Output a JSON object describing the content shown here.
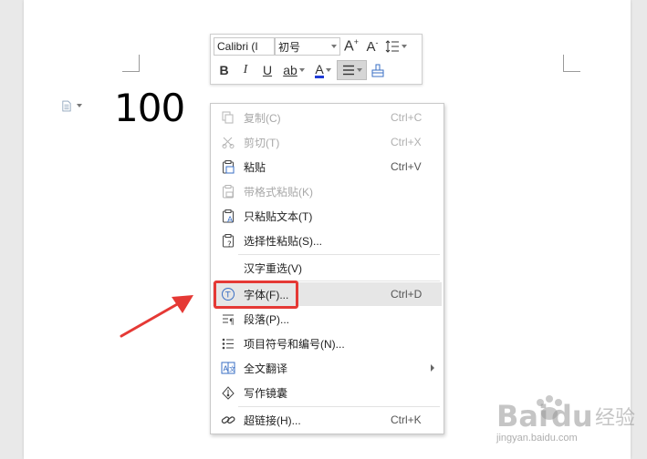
{
  "document": {
    "text": "100"
  },
  "toolbar": {
    "font_name": "Calibri (I",
    "font_size": "初号",
    "grow_font": "A",
    "shrink_font": "A",
    "bold": "B",
    "italic": "I",
    "underline": "U",
    "highlight": "ab",
    "font_color_letter": "A"
  },
  "menu": {
    "items": [
      {
        "label": "复制(C)",
        "shortcut": "Ctrl+C",
        "icon": "copy-icon",
        "enabled": false
      },
      {
        "label": "剪切(T)",
        "shortcut": "Ctrl+X",
        "icon": "cut-icon",
        "enabled": false
      },
      {
        "label": "粘贴",
        "shortcut": "Ctrl+V",
        "icon": "paste-icon",
        "enabled": true
      },
      {
        "label": "带格式粘贴(K)",
        "shortcut": "",
        "icon": "paste-format-icon",
        "enabled": false
      },
      {
        "label": "只粘贴文本(T)",
        "shortcut": "",
        "icon": "paste-text-icon",
        "enabled": true
      },
      {
        "label": "选择性粘贴(S)...",
        "shortcut": "",
        "icon": "paste-special-icon",
        "enabled": true
      },
      {
        "label": "汉字重选(V)",
        "shortcut": "",
        "icon": "",
        "enabled": true
      },
      {
        "label": "字体(F)...",
        "shortcut": "Ctrl+D",
        "icon": "font-icon",
        "enabled": true,
        "highlighted": true
      },
      {
        "label": "段落(P)...",
        "shortcut": "",
        "icon": "paragraph-icon",
        "enabled": true
      },
      {
        "label": "项目符号和编号(N)...",
        "shortcut": "",
        "icon": "bullets-icon",
        "enabled": true
      },
      {
        "label": "全文翻译",
        "shortcut": "",
        "icon": "translate-icon",
        "enabled": true,
        "submenu": true
      },
      {
        "label": "写作镜囊",
        "shortcut": "",
        "icon": "writing-icon",
        "enabled": true
      },
      {
        "label": "超链接(H)...",
        "shortcut": "Ctrl+K",
        "icon": "link-icon",
        "enabled": true
      }
    ]
  },
  "watermark": {
    "logo": "Bai du 经验",
    "url": "jingyan.baidu.com"
  },
  "colors": {
    "highlight_box": "#e53935",
    "arrow": "#e53935",
    "font_color_bar": "#1f3bd6"
  }
}
